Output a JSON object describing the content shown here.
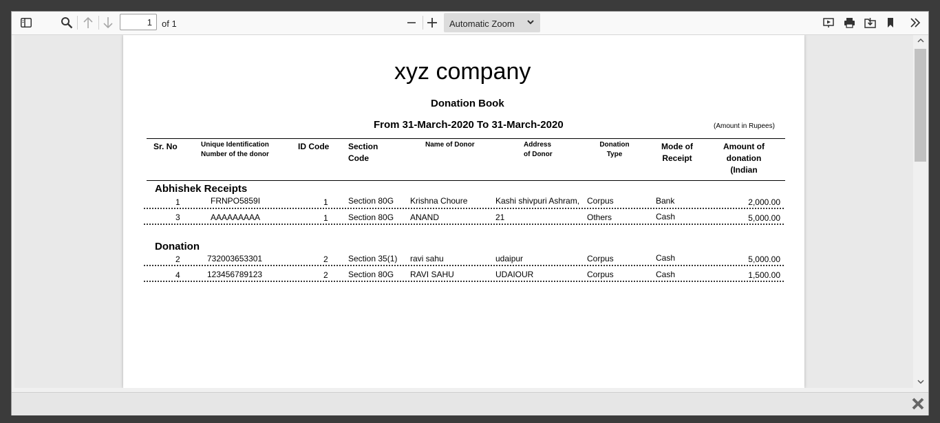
{
  "toolbar": {
    "page_number": "1",
    "page_count_label": "of 1",
    "zoom_label": "Automatic Zoom"
  },
  "report": {
    "company": "xyz company",
    "title": "Donation Book",
    "period": "From 31-March-2020 To 31-March-2020",
    "amount_note": "(Amount in Rupees)",
    "headers": {
      "sr_no": "Sr. No",
      "uid_line1": "Unique Identification",
      "uid_line2": "Number of the donor",
      "id_code": "ID Code",
      "section_line1": "Section",
      "section_line2": "Code",
      "donor_name": "Name of Donor",
      "address_line1": "Address",
      "address_line2": "of Donor",
      "dtype_line1": "Donation",
      "dtype_line2": "Type",
      "mode_line1": "Mode of",
      "mode_line2": "Receipt",
      "amount_line1": "Amount of",
      "amount_line2": "donation",
      "amount_line3": "(Indian"
    },
    "groups": [
      {
        "name": "Abhishek Receipts",
        "rows": [
          {
            "sr": "1",
            "uid": "FRNPO5859I",
            "id": "1",
            "section": "Section 80G",
            "name": "Krishna Choure",
            "address": "Kashi shivpuri Ashram,",
            "type": "Corpus",
            "mode": "Bank",
            "amount": "2,000.00"
          },
          {
            "sr": "3",
            "uid": "AAAAAAAAA",
            "id": "1",
            "section": "Section 80G",
            "name": "ANAND",
            "address": "21",
            "type": "Others",
            "mode": "Cash",
            "amount": "5,000.00"
          }
        ]
      },
      {
        "name": "Donation",
        "rows": [
          {
            "sr": "2",
            "uid": "732003653301",
            "id": "2",
            "section": "Section 35(1)",
            "name": "ravi sahu",
            "address": "udaipur",
            "type": "Corpus",
            "mode": "Cash",
            "amount": "5,000.00"
          },
          {
            "sr": "4",
            "uid": "123456789123",
            "id": "2",
            "section": "Section 80G",
            "name": "RAVI SAHU",
            "address": "UDAIOUR",
            "type": "Corpus",
            "mode": "Cash",
            "amount": "1,500.00"
          }
        ]
      }
    ]
  }
}
